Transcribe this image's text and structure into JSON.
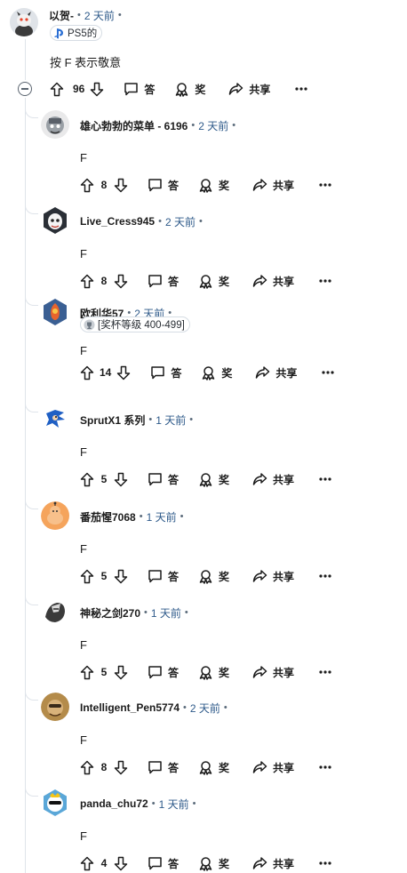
{
  "top_comment": {
    "author": "以贺-",
    "time": "2 天前",
    "flair": "PS5的",
    "body": "按 F 表示敬意",
    "votes": "96",
    "reply_label": "答",
    "award_label": "奖",
    "share_label": "共享"
  },
  "replies": [
    {
      "author": "雄心勃勃的菜单 - 6196",
      "time": "2 天前",
      "flair": "",
      "body": "F",
      "votes": "8",
      "reply_label": "答",
      "award_label": "奖",
      "share_label": "共享"
    },
    {
      "author": "Live_Cress945",
      "time": "2 天前",
      "flair": "",
      "body": "F",
      "votes": "8",
      "reply_label": "答",
      "award_label": "奖",
      "share_label": "共享"
    },
    {
      "author": "欧利华57",
      "time": "2 天前",
      "flair": "[奖杯等级 400-499]",
      "body": "F",
      "votes": "14",
      "reply_label": "答",
      "award_label": "奖",
      "share_label": "共享"
    },
    {
      "author": "SprutX1 系列",
      "time": "1 天前",
      "flair": "",
      "body": "F",
      "votes": "5",
      "reply_label": "答",
      "award_label": "奖",
      "share_label": "共享"
    },
    {
      "author": "番茄惺7068",
      "time": "1 天前",
      "flair": "",
      "body": "F",
      "votes": "5",
      "reply_label": "答",
      "award_label": "奖",
      "share_label": "共享"
    },
    {
      "author": "神秘之剑270",
      "time": "1 天前",
      "flair": "",
      "body": "F",
      "votes": "5",
      "reply_label": "答",
      "award_label": "奖",
      "share_label": "共享"
    },
    {
      "author": "Intelligent_Pen5774",
      "time": "2 天前",
      "flair": "",
      "body": "F",
      "votes": "8",
      "reply_label": "答",
      "award_label": "奖",
      "share_label": "共享"
    },
    {
      "author": "panda_chu72",
      "time": "1 天前",
      "flair": "",
      "body": "F",
      "votes": "4",
      "reply_label": "答",
      "award_label": "奖",
      "share_label": "共享"
    }
  ],
  "colors": {
    "time": "#2e5a8a",
    "thread_line": "#dfe4ea",
    "text": "#1c1c1c"
  },
  "icons": [
    "upvote-icon",
    "downvote-icon",
    "comment-icon",
    "award-icon",
    "share-icon",
    "more-icon",
    "collapse-icon",
    "playstation-icon",
    "trophy-icon"
  ]
}
